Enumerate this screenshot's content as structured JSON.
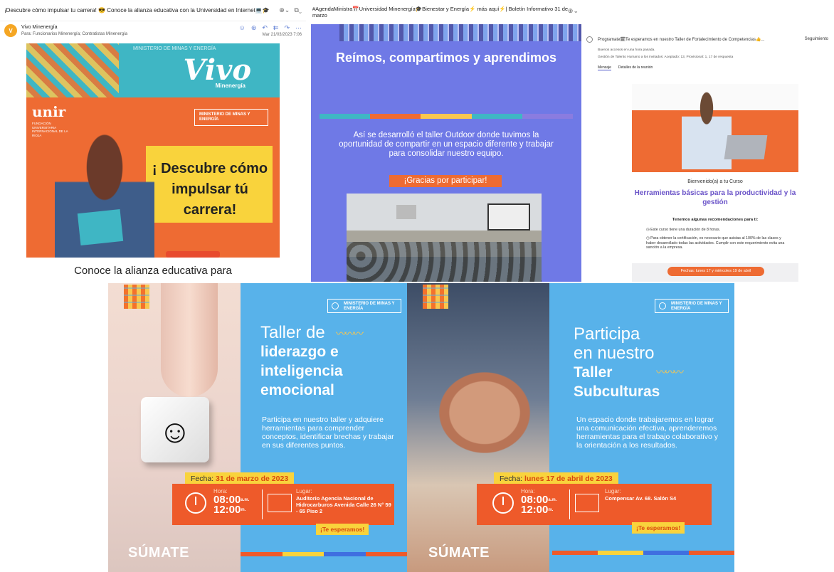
{
  "email": {
    "subject": "¡Descubre cómo impulsar tu carrera! 😎 Conoce la alianza educativa con la Universidad en Internet💻🎓",
    "zoom_icon": "zoom-icon",
    "sender": "Vivo Minenergía",
    "avatar_text": "V",
    "to_line": "Para:  Funcionarios Minenergía;  Contratistas Minenergía",
    "date": "Mar 21/03/2023 7:06",
    "banner_title": "Vivo",
    "banner_sub": "Minenergía",
    "banner_ministry": "MINISTERIO DE MINAS Y ENERGÍA",
    "unir_logo": "unir",
    "unir_sub": "FUNDACIÓN UNIVERSITARIA INTERNACIONAL DE LA RIOJA",
    "ministry_badge": "MINISTERIO DE MINAS Y ENERGÍA",
    "cta": "¡ Descubre cómo impulsar tú carrera!",
    "footer_text": "Conoce la alianza educativa para"
  },
  "boletin": {
    "subject": "#AgendaMinistra📅Universidad Minenergía🎓Bienestar y Energía⚡ más aquí⚡| Boletín Informativo 31 de marzo",
    "headline": "Reímos, compartimos y aprendimos",
    "body": "Así se desarrolló el taller Outdoor donde tuvimos la oportunidad de compartir en un espacio diferente y trabajar para consolidar nuestro equipo.",
    "thanks": "¡Gracias por participar!",
    "color_bar": [
      "#3fb6c4",
      "#ee6b33",
      "#f9c74f",
      "#3fb6c4",
      "#8a7ce0"
    ]
  },
  "teams": {
    "subject": "Programate🗓Te esperamos en nuestro Taller de Fortalecimiento de Competencias👍...",
    "following": "Seguimiento",
    "line1": "Buenos accesos en una hora pasada.",
    "line2": "Gestión de Talento Humano a los invitados: Aceptado: 13,  Provisional: 1,  17 de respuesta",
    "tab_active": "Mensaje",
    "tab_other": "Detalles de la reunión",
    "welcome": "Bienvenido(a) a tu Curso",
    "course_title": "Herramientas básicas para la productividad y la gestión",
    "recs_title": "Tenemos algunas recomendaciones para ti:",
    "bullet1": "Este curso tiene una duración de 8 horas.",
    "bullet2": "Para obtener la certificación, es necesario que asistas al 100% de las clases y haber desarrollado todas las actividades. Cumplir con este requerimiento evita una sanción a la empresa.",
    "dates": "Fechas: lunes 17 y miércoles 19 de abril"
  },
  "taller1": {
    "ministry": "MINISTERIO DE MINAS Y ENERGÍA",
    "title_light": "Taller de",
    "title_bold_1": "liderazgo e",
    "title_bold_2": "inteligencia",
    "title_bold_3": "emocional",
    "description": "Participa en nuestro taller y adquiere herramientas para comprender conceptos, identificar brechas y trabajar en sus diferentes puntos.",
    "fecha_label": "Fecha:",
    "fecha_value": "31 de marzo de 2023",
    "hora_label": "Hora:",
    "hora_start": "08:00",
    "hora_end": "12:00",
    "am": "a.m.",
    "pm": "m.",
    "lugar_label": "Lugar:",
    "lugar_value": "Auditorio Agencia Nacional de Hidrocarburos Avenida Calle 26 N° 59 - 65 Piso 2",
    "esperamos": "¡Te esperamos!",
    "sumate": "SÚMATE"
  },
  "taller2": {
    "ministry": "MINISTERIO DE MINAS Y ENERGÍA",
    "title_light_1": "Participa",
    "title_light_2": "en nuestro",
    "title_bold_1": "Taller",
    "title_bold_2": "Subculturas",
    "description": "Un espacio donde trabajaremos en lograr una comunicación efectiva, aprenderemos herramientas para el trabajo colaborativo y la orientación a los resultados.",
    "fecha_label": "Fecha:",
    "fecha_value": "lunes 17 de abril de 2023",
    "hora_label": "Hora:",
    "hora_start": "08:00",
    "hora_end": "12:00",
    "am": "a.m.",
    "pm": "m.",
    "lugar_label": "Lugar:",
    "lugar_value": "Compensar Av. 68. Salón S4",
    "esperamos": "¡Te esperamos!",
    "sumate": "SÚMATE"
  },
  "colors": {
    "poster_blue": "#58b2ea",
    "accent_orange": "#ee5a2a",
    "accent_yellow": "#f9d33c",
    "boletin_purple": "#6f79e6",
    "course_title": "#6a53c8"
  }
}
